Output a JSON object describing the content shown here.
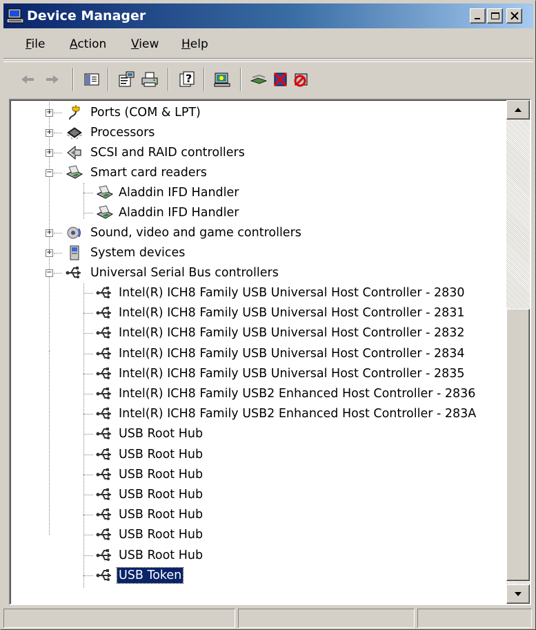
{
  "window": {
    "title": "Device Manager",
    "minimize_symbol": "_",
    "maximize_symbol": "□",
    "close_symbol": "x"
  },
  "menu": [
    {
      "label": "File",
      "accel": "F"
    },
    {
      "label": "Action",
      "accel": "A"
    },
    {
      "label": "View",
      "accel": "V"
    },
    {
      "label": "Help",
      "accel": "H"
    }
  ],
  "toolbar": {
    "buttons": [
      "back-icon",
      "forward-icon",
      "show-hide-console-tree-icon",
      "properties-icon",
      "print-icon",
      "help-icon",
      "scan-hardware-icon",
      "update-driver-icon",
      "uninstall-icon",
      "disable-icon"
    ]
  },
  "tree": {
    "items": [
      {
        "label": "Ports (COM & LPT)",
        "level": 1,
        "expander": "+",
        "icon": "port-icon"
      },
      {
        "label": "Processors",
        "level": 1,
        "expander": "+",
        "icon": "processor-icon"
      },
      {
        "label": "SCSI and RAID controllers",
        "level": 1,
        "expander": "+",
        "icon": "scsi-icon"
      },
      {
        "label": "Smart card readers",
        "level": 1,
        "expander": "−",
        "icon": "smartcard-reader-icon"
      },
      {
        "label": "Aladdin IFD Handler",
        "level": 2,
        "icon": "smartcard-reader-icon"
      },
      {
        "label": "Aladdin IFD Handler",
        "level": 2,
        "icon": "smartcard-reader-icon"
      },
      {
        "label": "Sound, video and game controllers",
        "level": 1,
        "expander": "+",
        "icon": "sound-icon"
      },
      {
        "label": "System devices",
        "level": 1,
        "expander": "+",
        "icon": "system-device-icon"
      },
      {
        "label": "Universal Serial Bus controllers",
        "level": 1,
        "expander": "−",
        "icon": "usb-icon"
      },
      {
        "label": "Intel(R) ICH8 Family USB Universal Host Controller - 2830",
        "level": 2,
        "icon": "usb-icon"
      },
      {
        "label": "Intel(R) ICH8 Family USB Universal Host Controller - 2831",
        "level": 2,
        "icon": "usb-icon"
      },
      {
        "label": "Intel(R) ICH8 Family USB Universal Host Controller - 2832",
        "level": 2,
        "icon": "usb-icon"
      },
      {
        "label": "Intel(R) ICH8 Family USB Universal Host Controller - 2834",
        "level": 2,
        "icon": "usb-icon"
      },
      {
        "label": "Intel(R) ICH8 Family USB Universal Host Controller - 2835",
        "level": 2,
        "icon": "usb-icon"
      },
      {
        "label": "Intel(R) ICH8 Family USB2 Enhanced Host Controller - 2836",
        "level": 2,
        "icon": "usb-icon"
      },
      {
        "label": "Intel(R) ICH8 Family USB2 Enhanced Host Controller - 283A",
        "level": 2,
        "icon": "usb-icon"
      },
      {
        "label": "USB Root Hub",
        "level": 2,
        "icon": "usb-icon"
      },
      {
        "label": "USB Root Hub",
        "level": 2,
        "icon": "usb-icon"
      },
      {
        "label": "USB Root Hub",
        "level": 2,
        "icon": "usb-icon"
      },
      {
        "label": "USB Root Hub",
        "level": 2,
        "icon": "usb-icon"
      },
      {
        "label": "USB Root Hub",
        "level": 2,
        "icon": "usb-icon"
      },
      {
        "label": "USB Root Hub",
        "level": 2,
        "icon": "usb-icon"
      },
      {
        "label": "USB Root Hub",
        "level": 2,
        "icon": "usb-icon"
      },
      {
        "label": "USB Token",
        "level": 2,
        "icon": "usb-icon",
        "selected": true
      }
    ]
  },
  "status": {
    "panes": [
      "",
      "",
      ""
    ]
  },
  "colors": {
    "titlebar_start": "#0a246a",
    "titlebar_end": "#a6caf0",
    "selection": "#0a246a",
    "face": "#d4d0c8"
  }
}
